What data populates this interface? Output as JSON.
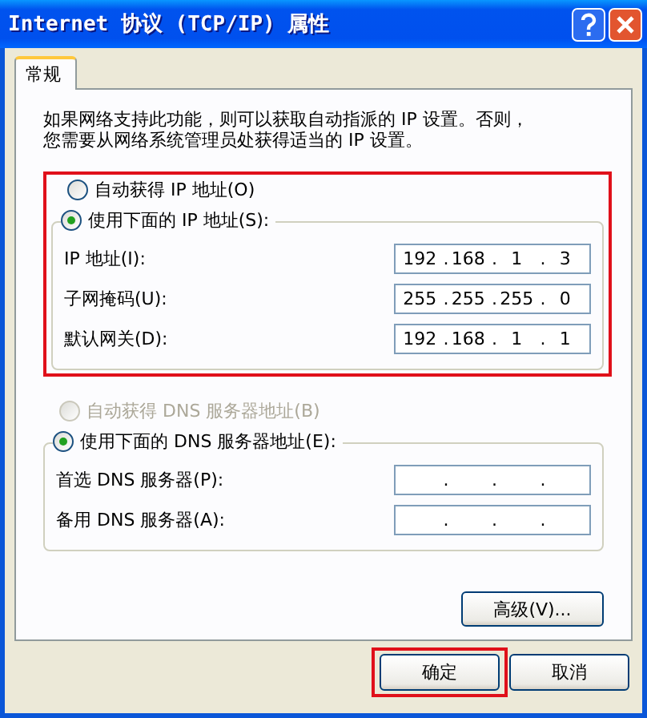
{
  "window": {
    "title": "Internet 协议 (TCP/IP) 属性"
  },
  "tabs": [
    {
      "label": "常规",
      "selected": true
    }
  ],
  "description": [
    "如果网络支持此功能，则可以获取自动指派的 IP 设置。否则，",
    "您需要从网络系统管理员处获得适当的 IP 设置。"
  ],
  "octet_separator": ".",
  "ip_section": {
    "highlighted": true,
    "options": [
      {
        "label": "自动获得 IP 地址(O)",
        "selected": false,
        "disabled": false
      },
      {
        "label": "使用下面的 IP 地址(S):",
        "selected": true,
        "disabled": false
      }
    ],
    "fields": [
      {
        "label": "IP 地址(I):",
        "octets": [
          "192",
          "168",
          "1",
          "3"
        ]
      },
      {
        "label": "子网掩码(U):",
        "octets": [
          "255",
          "255",
          "255",
          "0"
        ]
      },
      {
        "label": "默认网关(D):",
        "octets": [
          "192",
          "168",
          "1",
          "1"
        ]
      }
    ]
  },
  "dns_section": {
    "highlighted": false,
    "options": [
      {
        "label": "自动获得 DNS 服务器地址(B)",
        "selected": false,
        "disabled": true
      },
      {
        "label": "使用下面的 DNS 服务器地址(E):",
        "selected": true,
        "disabled": false
      }
    ],
    "fields": [
      {
        "label": "首选 DNS 服务器(P):"
      },
      {
        "label": "备用 DNS 服务器(A):"
      }
    ]
  },
  "advanced_button": {
    "label": "高级(V)..."
  },
  "buttons": [
    {
      "label": "确定",
      "highlighted": true
    },
    {
      "label": "取消",
      "highlighted": false
    }
  ]
}
